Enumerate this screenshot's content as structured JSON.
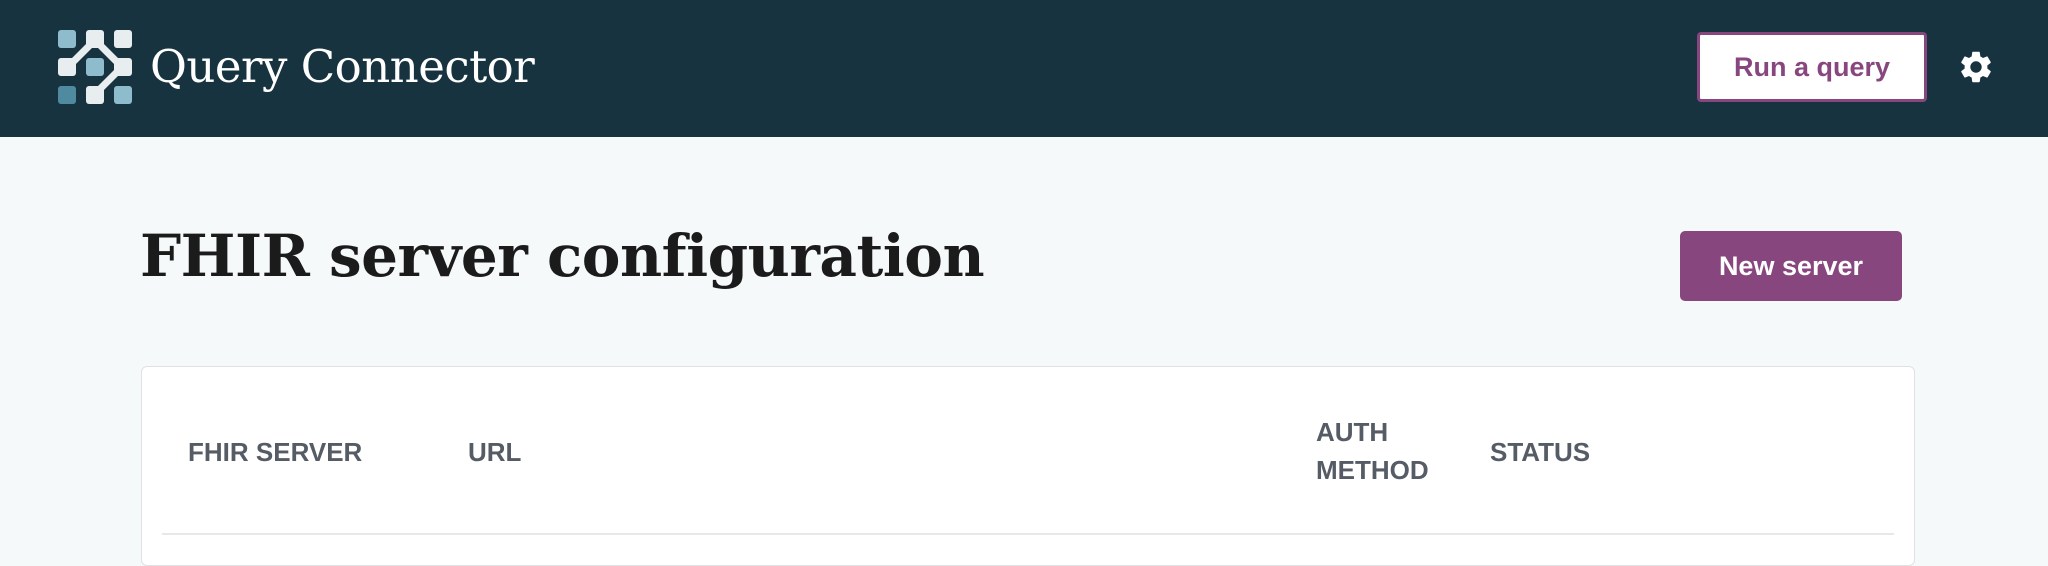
{
  "header": {
    "app_title": "Query Connector",
    "run_query_label": "Run a query",
    "logo_icon": "query-connector-logo-icon",
    "settings_icon": "gear-icon"
  },
  "main": {
    "page_title": "FHIR server configuration",
    "new_server_label": "New server"
  },
  "table": {
    "columns": [
      "FHIR SERVER",
      "URL",
      "AUTH METHOD",
      "STATUS"
    ],
    "auth_line1": "AUTH",
    "auth_line2": "METHOD"
  },
  "colors": {
    "header_bg": "#16333f",
    "accent": "#88467f",
    "page_bg": "#f6f9fa",
    "header_text": "#565c65"
  }
}
